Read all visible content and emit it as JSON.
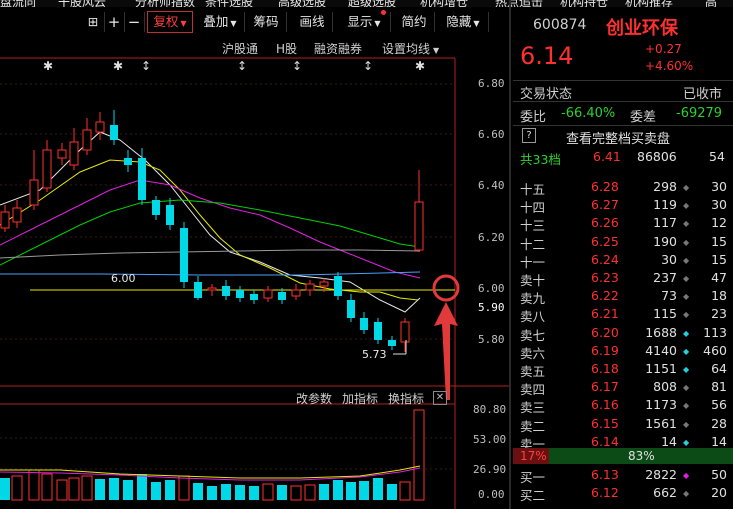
{
  "top_menu": [
    "盘流向",
    "干股风云",
    "分析师指数",
    "条件选股",
    "高级选股",
    "超级选股",
    "机构增仓",
    "热点追击",
    "机构持仓",
    "机构推荐",
    "高"
  ],
  "toolbar": {
    "lock": "⊞",
    "plus": "+",
    "minus": "−",
    "fuquan": "复权",
    "diejia": "叠加",
    "chouma": "筹码",
    "huaxian": "画线",
    "xianshi": "显示",
    "jianyue": "简约",
    "yincang": "隐藏"
  },
  "subbar": {
    "hugutong": "沪股通",
    "h": "H股",
    "rongzi": "融资融券",
    "junxian": "设置均线"
  },
  "price_axis": [
    "6.80",
    "6.60",
    "6.40",
    "6.20",
    "6.00",
    "5.90",
    "5.80"
  ],
  "vol_axis": [
    "80.80",
    "53.00",
    "26.90",
    "0.00"
  ],
  "indicator_bar": {
    "gai": "改参数",
    "jia": "加指标",
    "huan": "换指标"
  },
  "price_annotations": {
    "level_line": "6.00",
    "low_label": "5.73"
  },
  "quote": {
    "code": "600874",
    "name": "创业环保",
    "price": "6.14",
    "change": "+0.27",
    "change_pct": "+4.60%",
    "status_label": "交易状态",
    "status_value": "已收市",
    "weibi_label": "委比",
    "weibi_value": "-66.40%",
    "weicha_label": "委差",
    "weicha_value": "-69279",
    "full_book_link": "查看完整档买卖盘",
    "total_label": "共33档",
    "total_price": "6.41",
    "total_vol": "86806",
    "total_cnt": "54"
  },
  "sell_levels": [
    {
      "label": "十五",
      "price": "6.28",
      "vol": "298",
      "cnt": "30"
    },
    {
      "label": "十四",
      "price": "6.27",
      "vol": "119",
      "cnt": "30"
    },
    {
      "label": "十三",
      "price": "6.26",
      "vol": "117",
      "cnt": "12"
    },
    {
      "label": "十二",
      "price": "6.25",
      "vol": "190",
      "cnt": "15"
    },
    {
      "label": "十一",
      "price": "6.24",
      "vol": "30",
      "cnt": "15"
    },
    {
      "label": "卖十",
      "price": "6.23",
      "vol": "237",
      "cnt": "47"
    },
    {
      "label": "卖九",
      "price": "6.22",
      "vol": "73",
      "cnt": "18"
    },
    {
      "label": "卖八",
      "price": "6.21",
      "vol": "115",
      "cnt": "23"
    },
    {
      "label": "卖七",
      "price": "6.20",
      "vol": "1688",
      "cnt": "113"
    },
    {
      "label": "卖六",
      "price": "6.19",
      "vol": "4140",
      "cnt": "460"
    },
    {
      "label": "卖五",
      "price": "6.18",
      "vol": "1151",
      "cnt": "64"
    },
    {
      "label": "卖四",
      "price": "6.17",
      "vol": "808",
      "cnt": "81"
    },
    {
      "label": "卖三",
      "price": "6.16",
      "vol": "1173",
      "cnt": "56"
    },
    {
      "label": "卖二",
      "price": "6.15",
      "vol": "1561",
      "cnt": "28"
    },
    {
      "label": "卖一",
      "price": "6.14",
      "vol": "14",
      "cnt": "14"
    }
  ],
  "ratio_bar": {
    "left": "17%",
    "right": "83%"
  },
  "buy_levels": [
    {
      "label": "买一",
      "price": "6.13",
      "vol": "2822",
      "cnt": "50"
    },
    {
      "label": "买二",
      "price": "6.12",
      "vol": "662",
      "cnt": "20"
    }
  ],
  "colors": {
    "up": "#ff3030",
    "down": "#00d8e8",
    "yellow": "#e8e800",
    "green": "#00d000",
    "magenta": "#e020e0",
    "accent_red": "#e03a3a"
  }
}
